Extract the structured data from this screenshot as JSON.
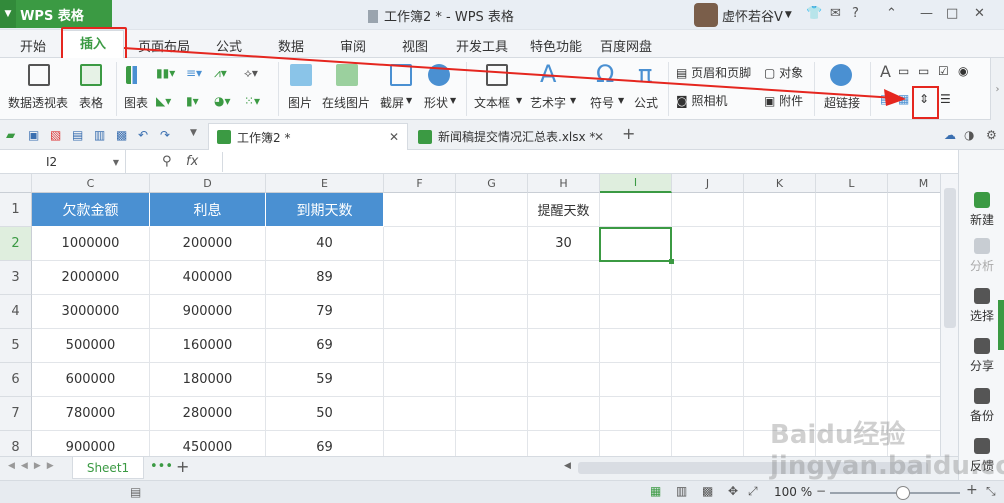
{
  "app": {
    "name": "WPS 表格",
    "window_title": "工作簿2 * - WPS 表格",
    "user": "虚怀若谷V"
  },
  "tabs": [
    "开始",
    "插入",
    "页面布局",
    "公式",
    "数据",
    "审阅",
    "视图",
    "开发工具",
    "特色功能",
    "百度网盘"
  ],
  "active_tab": "插入",
  "toolbar": {
    "pivot": "数据透视表",
    "table": "表格",
    "chart": "图表",
    "picture": "图片",
    "online_picture": "在线图片",
    "screenshot": "截屏",
    "shape": "形状",
    "textbox": "文本框",
    "wordart": "艺术字",
    "symbol": "符号",
    "formula": "公式",
    "header_footer": "页眉和页脚",
    "object": "对象",
    "camera": "照相机",
    "attachment": "附件",
    "hyperlink": "超链接"
  },
  "doc_tabs": [
    "工作簿2 *",
    "新闻稿提交情况汇总表.xlsx *"
  ],
  "formula_bar": {
    "name_box": "I2",
    "fx": "fx"
  },
  "columns": [
    "C",
    "D",
    "E",
    "F",
    "G",
    "H",
    "I",
    "J",
    "K",
    "L",
    "M"
  ],
  "rows": [
    "1",
    "2",
    "3",
    "4",
    "5",
    "6",
    "7",
    "8"
  ],
  "table": {
    "headers": [
      "欠款金额",
      "利息",
      "到期天数"
    ],
    "data": [
      [
        "1000000",
        "200000",
        "40"
      ],
      [
        "2000000",
        "400000",
        "89"
      ],
      [
        "3000000",
        "900000",
        "79"
      ],
      [
        "500000",
        "160000",
        "69"
      ],
      [
        "600000",
        "180000",
        "59"
      ],
      [
        "780000",
        "280000",
        "50"
      ],
      [
        "900000",
        "450000",
        "69"
      ]
    ],
    "reminder_label": "提醒天数",
    "reminder_value": "30"
  },
  "side_panel": [
    "新建",
    "分析",
    "选择",
    "分享",
    "备份",
    "反馈"
  ],
  "sheet_tab": "Sheet1",
  "zoom": "100 %",
  "watermark": "Baidu经验 jingyan.baidu.com",
  "colors": {
    "accent": "#3b9a43",
    "header_fill": "#4a90d2",
    "highlight": "#e5261f"
  }
}
